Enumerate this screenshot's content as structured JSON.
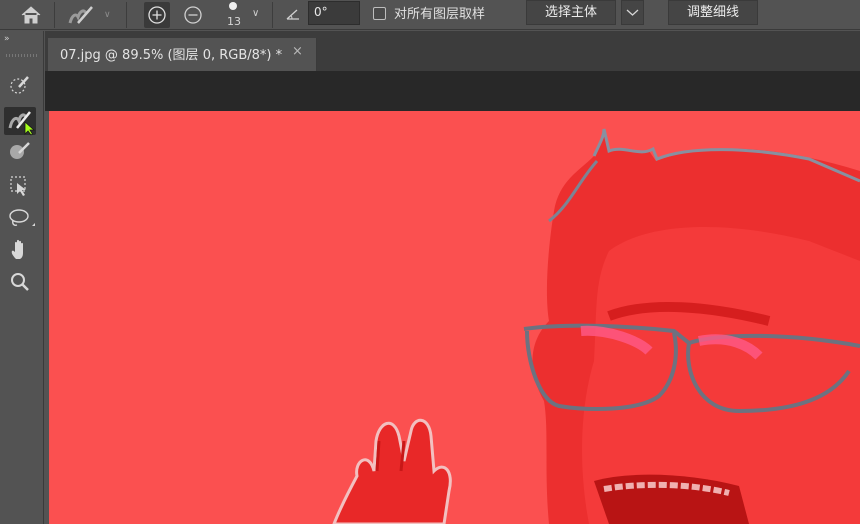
{
  "options_bar": {
    "brush_size": "13",
    "angle_value": "0°",
    "sample_all_layers_label": "对所有图层取样",
    "select_subject_label": "选择主体",
    "refine_edge_label": "调整细线"
  },
  "document_tab": {
    "title": "07.jpg @ 89.5% (图层 0, RGB/8*) *",
    "close_glyph": "×"
  },
  "toolbar": {
    "collapse_glyph": "»",
    "tools": [
      "quick-selection-brush-icon",
      "quick-mask-brush-icon",
      "mask-brush-icon",
      "object-selection-icon",
      "lasso-icon",
      "hand-icon",
      "zoom-icon"
    ],
    "active_tool": "quick-mask-brush-icon"
  },
  "colors": {
    "chrome": "#535353",
    "mask_overlay": "#fb5050",
    "active_tool_bg": "#2f2f2f",
    "cursor": "#a6ff1c"
  }
}
